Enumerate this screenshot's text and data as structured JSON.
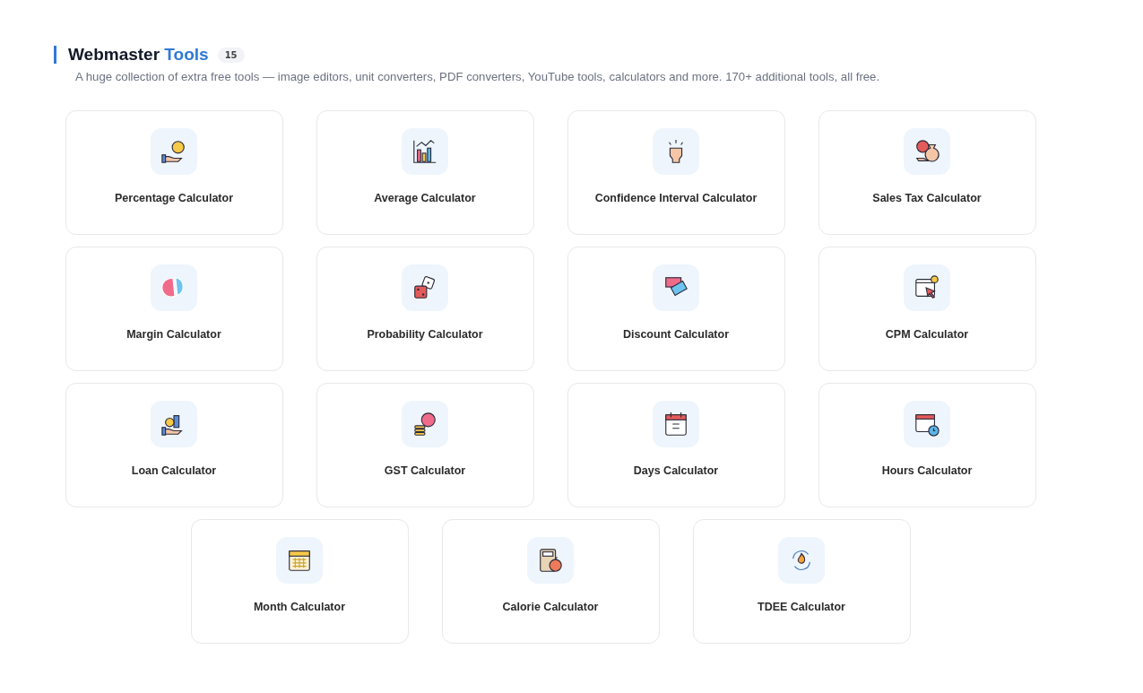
{
  "section": {
    "title": "Webmaster",
    "title_accent": "Tools",
    "count": "15",
    "description": "A huge collection of extra free tools — image editors, unit converters, PDF converters, YouTube tools, calculators and more. 170+ additional tools, all free."
  },
  "tools": [
    {
      "label": "Percentage Calculator"
    },
    {
      "label": "Average Calculator"
    },
    {
      "label": "Confidence Interval Calculator"
    },
    {
      "label": "Sales Tax Calculator"
    },
    {
      "label": "Margin Calculator"
    },
    {
      "label": "Probability Calculator"
    },
    {
      "label": "Discount Calculator"
    },
    {
      "label": "CPM Calculator"
    },
    {
      "label": "Loan Calculator"
    },
    {
      "label": "GST Calculator"
    },
    {
      "label": "Days Calculator"
    },
    {
      "label": "Hours Calculator"
    },
    {
      "label": "Month Calculator"
    },
    {
      "label": "Calorie Calculator"
    },
    {
      "label": "TDEE Calculator"
    }
  ]
}
